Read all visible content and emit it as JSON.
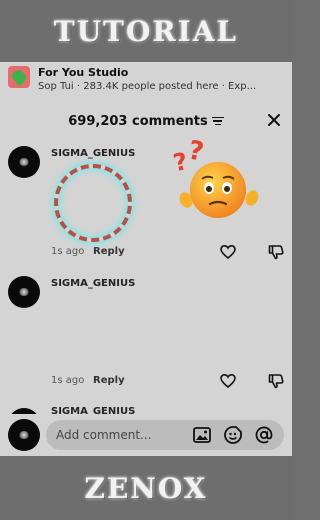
{
  "overlay": {
    "top_title": "TUTORIAL",
    "bottom_title": "ZENOX"
  },
  "sound": {
    "name": "For You Studio",
    "meta": "Sop Tui · 283.4K people posted here · Exp..."
  },
  "comments_header": {
    "count_label": "699,203 comments"
  },
  "comments": [
    {
      "username": "SIGMA_GENIUS",
      "time": "1s ago",
      "reply_label": "Reply"
    },
    {
      "username": "SIGMA_GENIUS",
      "time": "1s ago",
      "reply_label": "Reply"
    },
    {
      "username": "SIGMA_GENIUS"
    }
  ],
  "composer": {
    "placeholder": "Add comment..."
  },
  "colors": {
    "panel_bg": "#d4d4d4",
    "overlay_bg": "#6e6e6e",
    "dashed_circle": "#b8504a",
    "glow": "#7fe6e6",
    "question_marks": "#e8402a"
  },
  "icons": [
    "location-pin-icon",
    "filter-icon",
    "close-icon",
    "heart-icon",
    "dislike-icon",
    "image-icon",
    "emoji-icon",
    "mention-icon"
  ]
}
